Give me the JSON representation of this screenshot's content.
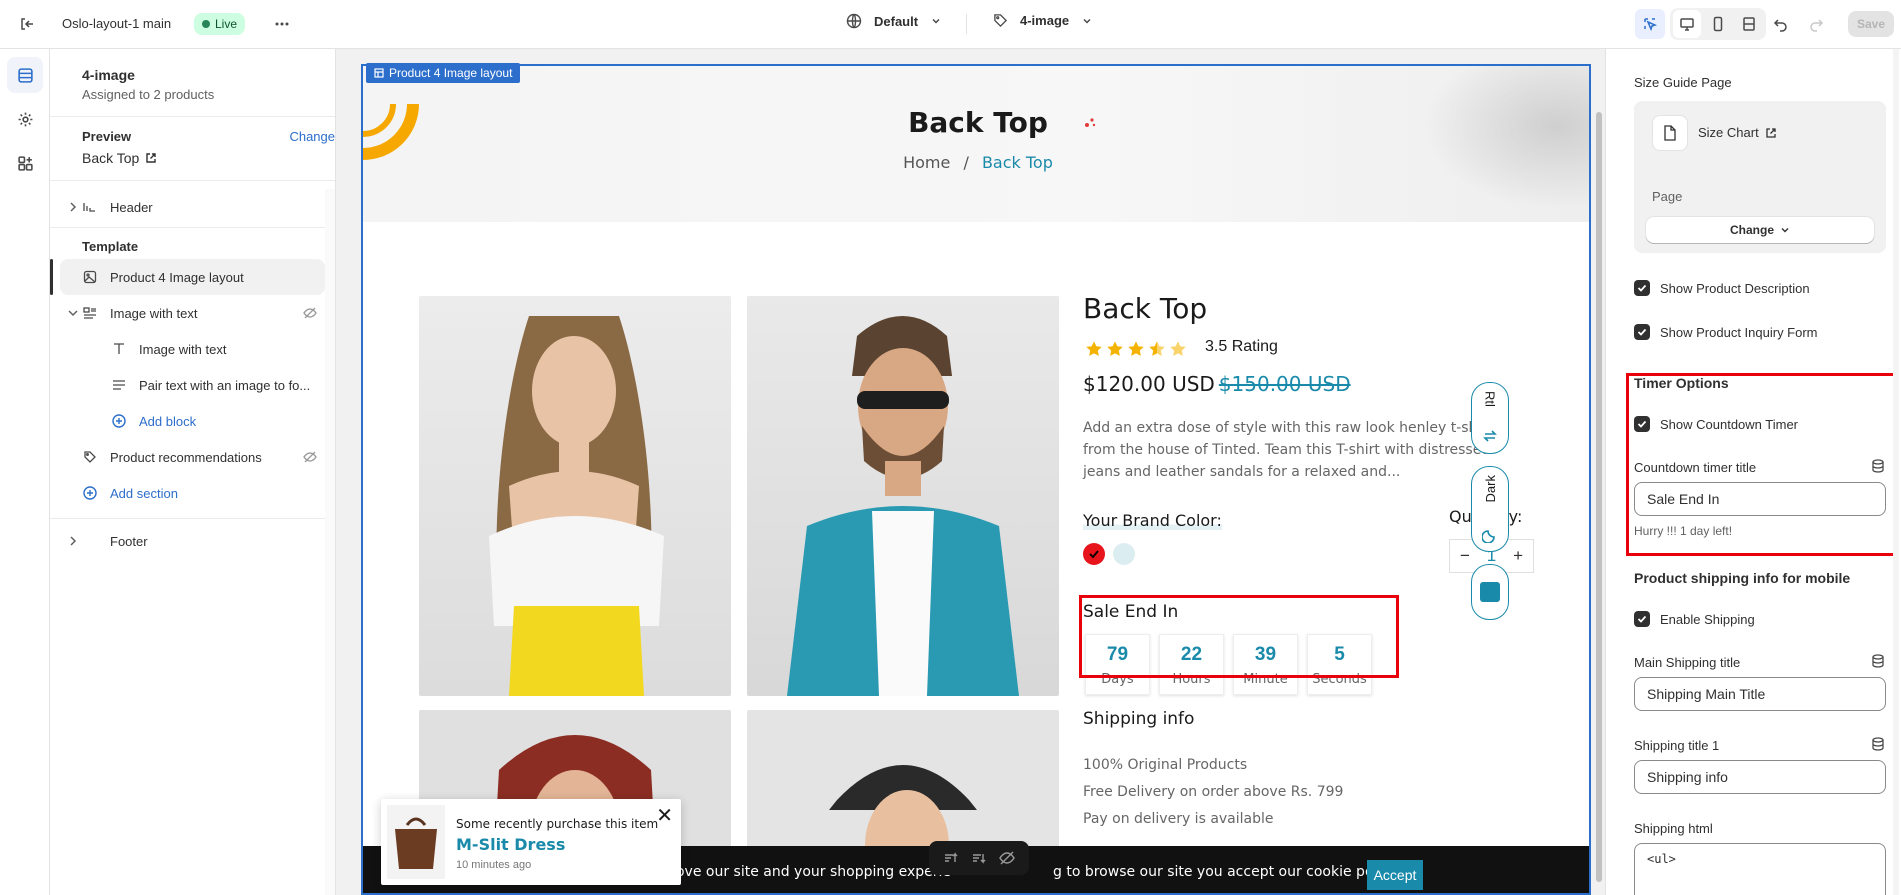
{
  "topbar": {
    "theme_name": "Oslo-layout-1 main",
    "status_badge": "Live",
    "locale": "Default",
    "template": "4-image",
    "save": "Save"
  },
  "sidebar": {
    "title": "4-image",
    "subtitle": "Assigned to 2 products",
    "preview_label": "Preview",
    "preview_change": "Change",
    "preview_value": "Back Top",
    "header": "Header",
    "template_label": "Template",
    "items": [
      {
        "label": "Product 4 Image layout"
      },
      {
        "label": "Image with text"
      },
      {
        "label": "Image with text"
      },
      {
        "label": "Pair text with an image to fo..."
      },
      {
        "label": "Add block"
      },
      {
        "label": "Product recommendations"
      },
      {
        "label": "Add section"
      }
    ],
    "footer": "Footer"
  },
  "canvas": {
    "section_tag": "Product 4 Image layout",
    "hero_title": "Back Top",
    "breadcrumb_home": "Home",
    "breadcrumb_sep": "/",
    "breadcrumb_current": "Back Top",
    "product_title": "Back Top",
    "rating": 3.5,
    "rating_text": "3.5 Rating",
    "price": "$120.00 USD",
    "price_old": "$150.00 USD",
    "description": "Add an extra dose of style with this raw look henley t-shirt from the house of Tinted. Team this T-shirt with distressed jeans and leather sandals for a relaxed and...",
    "brand_color_label": "Your Brand Color:",
    "quantity_label": "Quantity:",
    "quantity": "1",
    "sale_title": "Sale End In",
    "countdown": [
      {
        "value": "79",
        "unit": "Days"
      },
      {
        "value": "22",
        "unit": "Hours"
      },
      {
        "value": "39",
        "unit": "Minute"
      },
      {
        "value": "5",
        "unit": "Seconds"
      }
    ],
    "shipping_title": "Shipping info",
    "shipping_lines": [
      "100% Original Products",
      "Free Delivery on order above Rs. 799",
      "Pay on delivery is available"
    ],
    "rtl_label": "Rtl",
    "dark_label": "Dark",
    "cookie_text": "mprove our site and your shopping experie",
    "cookie_text2": "g to browse our site you accept our cookie policy.",
    "accept": "Accept",
    "toast_who": "Some recently purchase this item",
    "toast_product": "M-Slit Dress",
    "toast_time": "10 minutes ago",
    "swatch_colors": [
      "#e8141b",
      "#dcedf1"
    ],
    "accent": "#1a8aaa"
  },
  "rightpanel": {
    "size_guide_label": "Size Guide Page",
    "size_chart": "Size Chart",
    "page_label": "Page",
    "change": "Change",
    "show_desc": "Show Product Description",
    "show_inquiry": "Show Product Inquiry Form",
    "timer_options": "Timer Options",
    "show_countdown": "Show Countdown Timer",
    "countdown_title_label": "Countdown timer title",
    "countdown_title_value": "Sale End In",
    "hurry": "Hurry !!! 1 day left!",
    "shipping_mobile": "Product shipping info for mobile",
    "enable_shipping": "Enable Shipping",
    "main_shipping_label": "Main Shipping title",
    "main_shipping_value": "Shipping Main Title",
    "shipping_title1_label": "Shipping title 1",
    "shipping_title1_value": "Shipping info",
    "shipping_html_label": "Shipping html",
    "shipping_html_value": "<ul>"
  }
}
